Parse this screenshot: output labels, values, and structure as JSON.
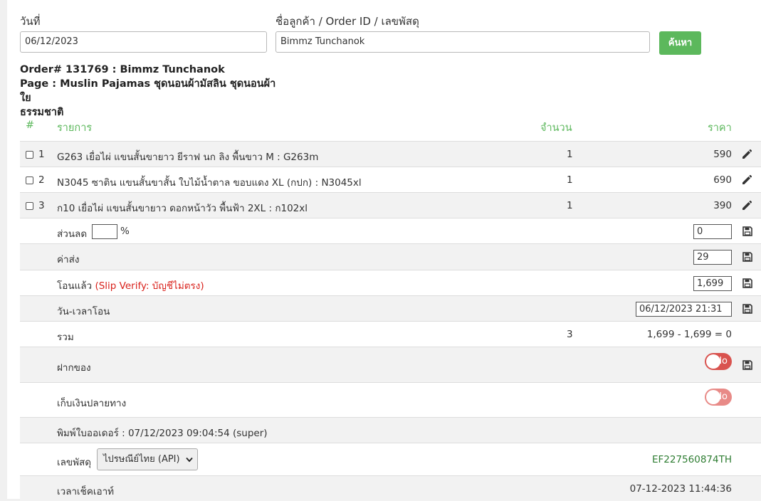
{
  "search": {
    "date_label": "วันที่",
    "date_value": "06/12/2023",
    "customer_label": "ชื่อลูกค้า / Order ID / เลขพัสดุ",
    "customer_value": "Bimmz Tunchanok",
    "search_button": "ค้นหา"
  },
  "order": {
    "title": "Order# 131769 : Bimmz Tunchanok",
    "page_line1": "Page : Muslin Pajamas ชุดนอนผ้ามัสลิน ชุดนอนผ้าใย",
    "page_line2": "ธรรมชาติ"
  },
  "table": {
    "headers": {
      "num": "#",
      "item": "รายการ",
      "qty": "จำนวน",
      "price": "ราคา"
    },
    "items": [
      {
        "num": "1",
        "name": "G263 เยื่อไผ่ แขนสั้นขายาว ยีราฟ นก ลิง พื้นขาว M : G263m",
        "qty": "1",
        "price": "590"
      },
      {
        "num": "2",
        "name": "N3045 ซาติน แขนสั้นขาสั้น ใบไม้น้ำตาล ขอบแดง XL (กปก) : N3045xl",
        "qty": "1",
        "price": "690"
      },
      {
        "num": "3",
        "name": "ก10 เยื่อไผ่ แขนสั้นขายาว ดอกหน้าวัว พื้นฟ้า 2XL : ก102xl",
        "qty": "1",
        "price": "390"
      }
    ]
  },
  "summary": {
    "discount_label": "ส่วนลด",
    "discount_percent": "",
    "percent_sign": "%",
    "discount_value": "0",
    "shipping_label": "ค่าส่ง",
    "shipping_value": "29",
    "transferred_label": "โอนแล้ว",
    "slip_verify": "(Slip Verify: บัญชีไม่ตรง)",
    "transferred_value": "1,699",
    "transfer_time_label": "วัน-เวลาโอน",
    "transfer_time_value": "06/12/2023 21:31",
    "total_label": "รวม",
    "total_qty": "3",
    "total_formula": "1,699 - 1,699 = 0",
    "deposit_label": "ฝากของ",
    "deposit_toggle": "No",
    "cod_label": "เก็บเงินปลายทาง",
    "cod_toggle": "No",
    "printed_text": "พิมพ์ใบออเดอร์ : 07/12/2023 09:04:54 (super)",
    "tracking_label": "เลขพัสดุ",
    "tracking_carrier": "ไปรษณีย์ไทย (API)",
    "tracking_number": "EF227560874TH",
    "checkout_label": "เวลาเช็คเอาท์",
    "checkout_time": "07-12-2023 11:44:36"
  },
  "colors": {
    "accent_green": "#5cb85c",
    "tracking_green": "#2e7d32",
    "toggle_red": "#d9534f",
    "toggle_red_light": "#e88a87",
    "warning_red": "#d9221c"
  }
}
